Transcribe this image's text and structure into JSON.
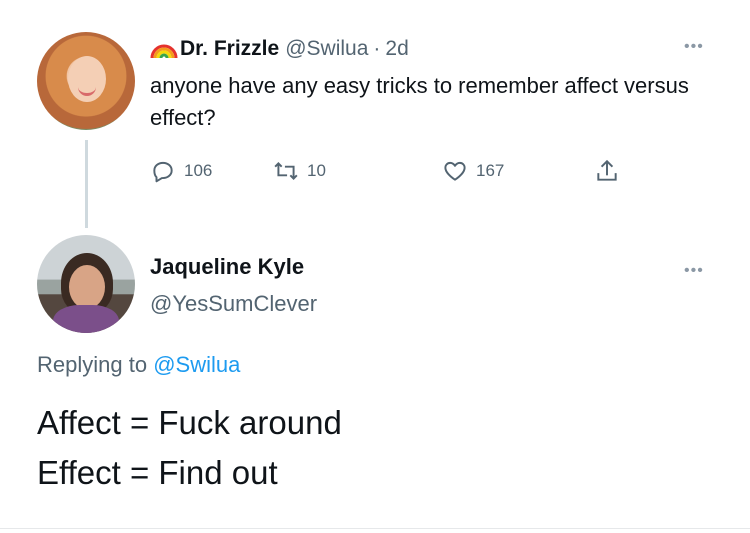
{
  "tweet": {
    "author": {
      "display_name": "Dr. Frizzle",
      "name_emoji": "rainbow-icon",
      "handle": "@Swilua",
      "separator": "·",
      "time": "2d"
    },
    "more_icon": "more-icon",
    "text": "anyone have any easy tricks to remember affect versus effect?",
    "stats": {
      "replies": "106",
      "retweets": "10",
      "likes": "167"
    }
  },
  "reply": {
    "author": {
      "display_name": "Jaqueline Kyle",
      "handle": "@YesSumClever"
    },
    "more_icon": "more-icon",
    "replying_prefix": "Replying to",
    "replying_to": "@Swilua",
    "lines": [
      "Affect = Fuck around",
      "Effect = Find out"
    ]
  },
  "colors": {
    "text_primary": "#0f1419",
    "text_secondary": "#536471",
    "link": "#1d9bf0",
    "thread_line": "#cfd9de"
  }
}
